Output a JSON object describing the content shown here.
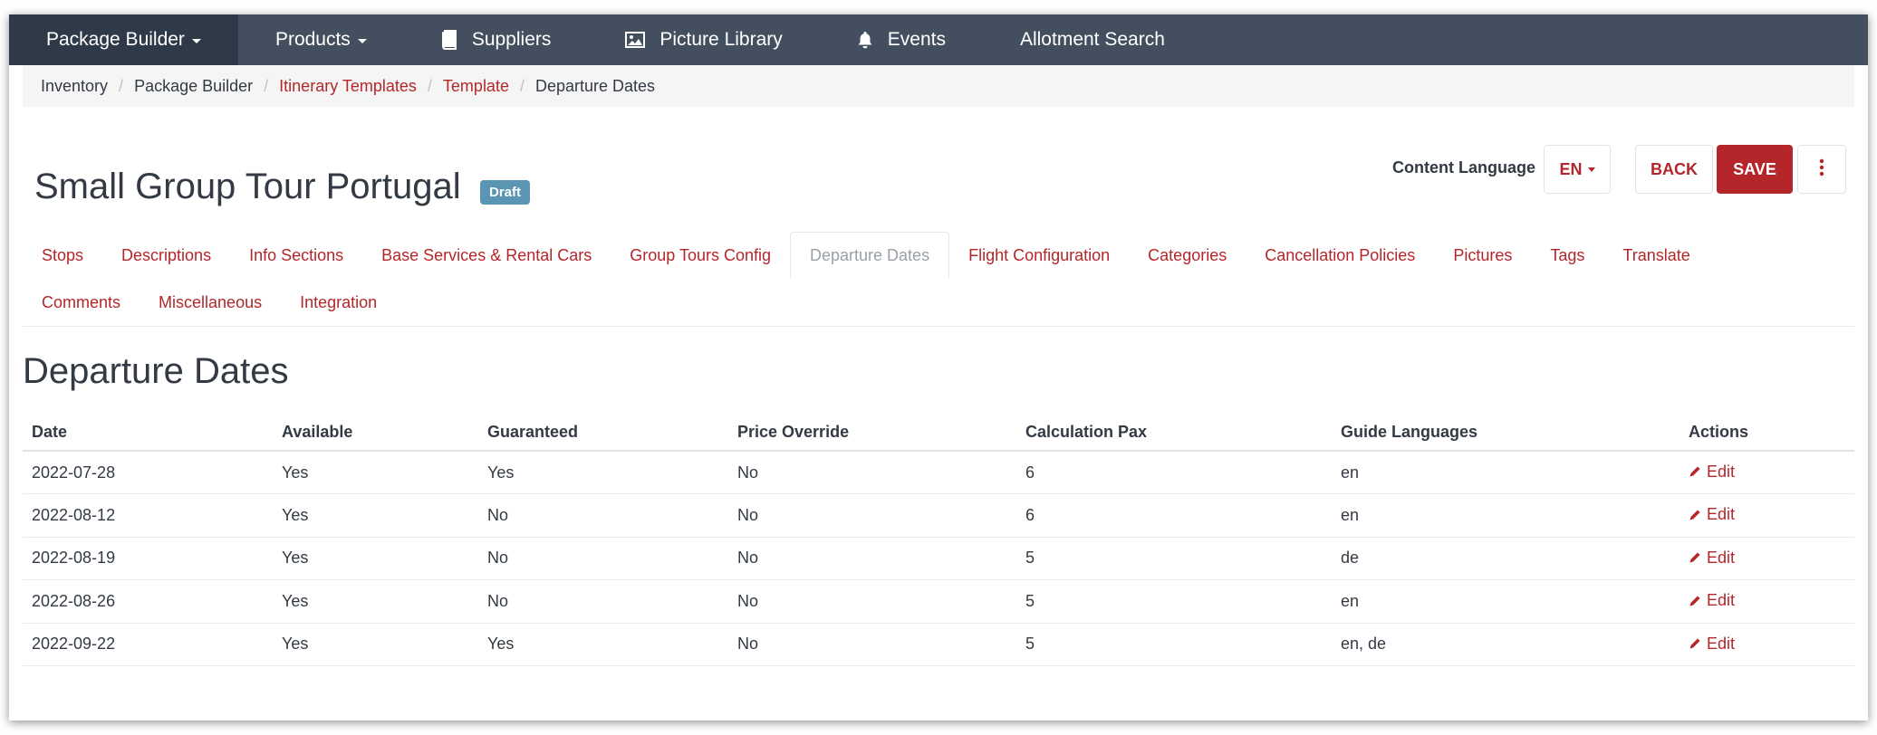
{
  "nav": {
    "items": [
      {
        "label": "Package Builder",
        "icon": "",
        "dropdown": true,
        "active": true
      },
      {
        "label": "Products",
        "icon": "",
        "dropdown": true,
        "active": false
      },
      {
        "label": "Suppliers",
        "icon": "book-icon",
        "dropdown": false,
        "active": false
      },
      {
        "label": "Picture Library",
        "icon": "image-icon",
        "dropdown": false,
        "active": false
      },
      {
        "label": "Events",
        "icon": "bell-icon",
        "dropdown": false,
        "active": false
      },
      {
        "label": "Allotment Search",
        "icon": "",
        "dropdown": false,
        "active": false
      }
    ]
  },
  "breadcrumb": [
    {
      "label": "Inventory",
      "link": false
    },
    {
      "label": "Package Builder",
      "link": false
    },
    {
      "label": "Itinerary Templates",
      "link": true
    },
    {
      "label": "Template",
      "link": true
    },
    {
      "label": "Departure Dates",
      "link": false
    }
  ],
  "header": {
    "title": "Small Group Tour Portugal",
    "status": "Draft",
    "content_language_label": "Content Language",
    "language": "EN",
    "back_label": "BACK",
    "save_label": "SAVE"
  },
  "tabs": {
    "row1": [
      "Stops",
      "Descriptions",
      "Info Sections",
      "Base Services & Rental Cars",
      "Group Tours Config",
      "Departure Dates",
      "Flight Configuration",
      "Categories",
      "Cancellation Policies",
      "Pictures",
      "Tags",
      "Translate"
    ],
    "row2": [
      "Comments",
      "Miscellaneous",
      "Integration"
    ],
    "active": "Departure Dates"
  },
  "section": {
    "title": "Departure Dates"
  },
  "table": {
    "columns": [
      "Date",
      "Available",
      "Guaranteed",
      "Price Override",
      "Calculation Pax",
      "Guide Languages",
      "Actions"
    ],
    "action_label": "Edit",
    "rows": [
      [
        "2022-07-28",
        "Yes",
        "Yes",
        "No",
        "6",
        "en"
      ],
      [
        "2022-08-12",
        "Yes",
        "No",
        "No",
        "6",
        "en"
      ],
      [
        "2022-08-19",
        "Yes",
        "No",
        "No",
        "5",
        "de"
      ],
      [
        "2022-08-26",
        "Yes",
        "No",
        "No",
        "5",
        "en"
      ],
      [
        "2022-09-22",
        "Yes",
        "Yes",
        "No",
        "5",
        "en, de"
      ]
    ]
  },
  "colors": {
    "navbar": "#434f5e",
    "navbar_active": "#2f3a48",
    "accent": "#b4262a",
    "badge": "#5b95b4"
  }
}
